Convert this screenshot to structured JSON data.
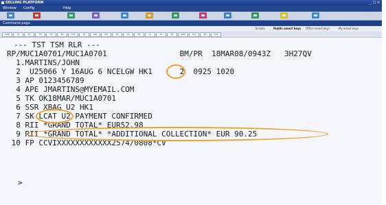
{
  "window": {
    "title": "SELLING PLATFORM",
    "controls": "_ □ ×"
  },
  "menu": [
    "Window",
    "Config",
    "Help"
  ],
  "toolbar": {
    "icon_colors": [
      "#3f7fd0",
      "#c43b2a",
      "#2d9b5a",
      "#7a5bc9",
      "#3a8ad8",
      "#d89a2a",
      "#2d9b5a",
      "#c43b7a",
      "#3f7fd0",
      "#2d9b5a",
      "#d8c02a",
      "#3a8ad8"
    ]
  },
  "command_bar": {
    "label": "Command page"
  },
  "options": [
    "Scripts",
    "Public smart keys",
    "Office smart keys",
    "My smart keys"
  ],
  "function_keys": [
    "CMD",
    "F1",
    "F2",
    "F3",
    "F4",
    "F5",
    "TST",
    "F6",
    "MD",
    "MU",
    "RT",
    "DA",
    "ER",
    "IG",
    "TK",
    "RF",
    "ANM",
    "FXX",
    "RE",
    "FXP"
  ],
  "terminal": {
    "lines": [
      "--- TST TSM RLR ---",
      "RP/MUC1A0701/MUC1A0701                BM/PR  18MAR08/0943Z   3H27QV",
      "  1.MARTINS/JOHN",
      "  2  U25066 Y 16AUG 6 NCELGW HK1      2  0925 1020",
      "  3 AP 0123456789",
      "  4 APE JMARTINS@MYEMAIL.COM",
      "  5 TK OK18MAR/MUC1A0701",
      "  6 SSR XBAG U2 HK1",
      "  7 SK LCAT U2 PAYMENT CONFIRMED",
      "  8 RII *GRAND TOTAL* EUR52.98",
      "  9 RII *GRAND TOTAL* *ADDITIONAL COLLECTION* EUR 90.25",
      " 10 FP CCVIXXXXXXXXXXXX2574/0808*CV",
      "",
      ">"
    ]
  },
  "colors": {
    "highlight": "#f0a028",
    "terminal_bg": "#f4f6fb",
    "menubar_bg": "#24468f"
  }
}
